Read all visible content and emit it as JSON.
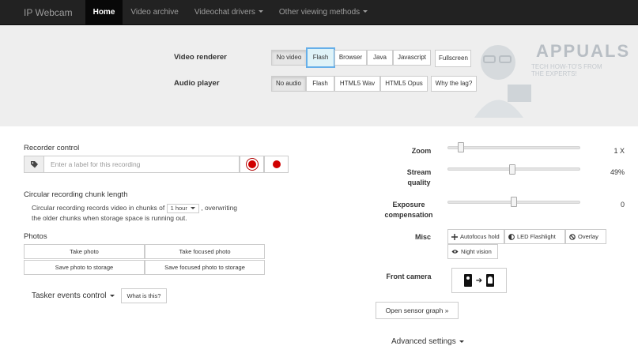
{
  "navbar": {
    "brand": "IP Webcam",
    "items": [
      "Home",
      "Video archive",
      "Videochat drivers",
      "Other viewing methods"
    ]
  },
  "video_renderer": {
    "label": "Video renderer",
    "options": [
      "No video",
      "Flash",
      "Browser",
      "Java",
      "Javascript"
    ],
    "fullscreen": "Fullscreen"
  },
  "audio_player": {
    "label": "Audio player",
    "options": [
      "No audio",
      "Flash",
      "HTML5 Wav",
      "HTML5 Opus"
    ],
    "why_lag": "Why the lag?"
  },
  "watermark": {
    "title": "APPUALS",
    "subtitle_1": "TECH HOW-TO'S FROM",
    "subtitle_2": "THE EXPERTS!"
  },
  "recorder": {
    "title": "Recorder control",
    "placeholder": "Enter a label for this recording"
  },
  "chunk": {
    "title": "Circular recording chunk length",
    "text_before": "Circular recording records video in chunks of",
    "value": "1 hour",
    "text_after": ", overwriting",
    "text_line2": "the older chunks when storage space is running out."
  },
  "photos": {
    "title": "Photos",
    "take_photo": "Take photo",
    "take_focused": "Take focused photo",
    "save_photo": "Save photo to storage",
    "save_focused": "Save focused photo to storage"
  },
  "tasker": {
    "label": "Tasker events control",
    "what": "What is this?"
  },
  "controls": {
    "zoom": {
      "label": "Zoom",
      "value": "1 X",
      "level": 0.08
    },
    "quality": {
      "label_1": "Stream",
      "label_2": "quality",
      "value": "49%",
      "level": 0.49
    },
    "exposure": {
      "label_1": "Exposure",
      "label_2": "compensation",
      "value": "0",
      "level": 0.5
    },
    "misc": {
      "label": "Misc",
      "autofocus": "Autofocus hold",
      "led": "LED Flashlight",
      "overlay": "Overlay",
      "night": "Night vision"
    },
    "front_camera": "Front camera"
  },
  "sensor_graph": "Open sensor graph »",
  "advanced": "Advanced settings"
}
